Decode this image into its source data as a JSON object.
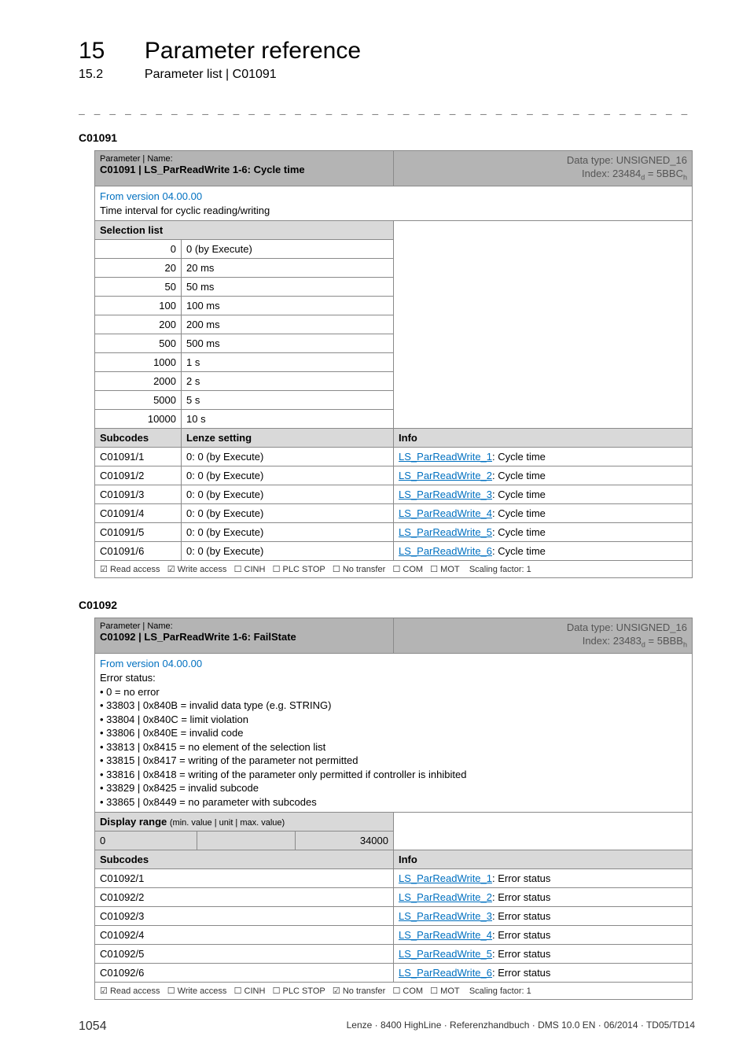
{
  "header": {
    "chapter_num": "15",
    "chapter_title": "Parameter reference",
    "section_num": "15.2",
    "section_title": "Parameter list | C01091",
    "rule": "_ _ _ _ _ _ _ _ _ _ _ _ _ _ _ _ _ _ _ _ _ _ _ _ _ _ _ _ _ _ _ _ _ _ _ _ _ _ _ _ _ _ _ _ _ _ _ _ _ _ _ _ _ _ _ _ _ _ _ _ _ _ _ _"
  },
  "t1": {
    "anchor": "C01091",
    "head_left_label": "Parameter | Name:",
    "head_left_title": "C01091 | LS_ParReadWrite 1-6: Cycle time",
    "head_right_1": "Data type: UNSIGNED_16",
    "head_right_2": "Index: 23484d = 5BBCh",
    "version": "From version 04.00.00",
    "desc": "Time interval for cyclic reading/writing",
    "sel_label": "Selection list",
    "rows": [
      {
        "k": "0",
        "v": "0 (by Execute)"
      },
      {
        "k": "20",
        "v": "20 ms"
      },
      {
        "k": "50",
        "v": "50 ms"
      },
      {
        "k": "100",
        "v": "100 ms"
      },
      {
        "k": "200",
        "v": "200 ms"
      },
      {
        "k": "500",
        "v": "500 ms"
      },
      {
        "k": "1000",
        "v": "1 s"
      },
      {
        "k": "2000",
        "v": "2 s"
      },
      {
        "k": "5000",
        "v": "5 s"
      },
      {
        "k": "10000",
        "v": "10 s"
      }
    ],
    "sub_h1": "Subcodes",
    "sub_h2": "Lenze setting",
    "sub_h3": "Info",
    "subs": [
      {
        "c": "C01091/1",
        "s": "0: 0 (by Execute)",
        "l": "LS_ParReadWrite_1",
        "t": ": Cycle time"
      },
      {
        "c": "C01091/2",
        "s": "0: 0 (by Execute)",
        "l": "LS_ParReadWrite_2",
        "t": ": Cycle time"
      },
      {
        "c": "C01091/3",
        "s": "0: 0 (by Execute)",
        "l": "LS_ParReadWrite_3",
        "t": ": Cycle time"
      },
      {
        "c": "C01091/4",
        "s": "0: 0 (by Execute)",
        "l": "LS_ParReadWrite_4",
        "t": ": Cycle time"
      },
      {
        "c": "C01091/5",
        "s": "0: 0 (by Execute)",
        "l": "LS_ParReadWrite_5",
        "t": ": Cycle time"
      },
      {
        "c": "C01091/6",
        "s": "0: 0 (by Execute)",
        "l": "LS_ParReadWrite_6",
        "t": ": Cycle time"
      }
    ],
    "foot": {
      "read": "Read access",
      "write": "Write access",
      "cinh": "CINH",
      "plc": "PLC STOP",
      "nt": "No transfer",
      "com": "COM",
      "mot": "MOT",
      "scale": "Scaling factor: 1",
      "read_c": "☑",
      "write_c": "☑",
      "cinh_c": "☐",
      "plc_c": "☐",
      "nt_c": "☐",
      "com_c": "☐",
      "mot_c": "☐"
    }
  },
  "t2": {
    "anchor": "C01092",
    "head_left_label": "Parameter | Name:",
    "head_left_title": "C01092 | LS_ParReadWrite 1-6: FailState",
    "head_right_1": "Data type: UNSIGNED_16",
    "head_right_2": "Index: 23483d = 5BBBh",
    "version": "From version 04.00.00",
    "desc_lines": [
      "Error status:",
      "• 0 = no error",
      "• 33803 | 0x840B = invalid data type (e.g. STRING)",
      "• 33804 | 0x840C = limit violation",
      "• 33806 | 0x840E = invalid code",
      "• 33813 | 0x8415 = no element of the selection list",
      "• 33815 | 0x8417 = writing of the parameter not permitted",
      "• 33816 | 0x8418 = writing of the parameter only permitted if controller is inhibited",
      "• 33829 | 0x8425 = invalid subcode",
      "• 33865 | 0x8449 = no parameter with subcodes"
    ],
    "display_label": "Display range (min. value | unit | max. value)",
    "range_min": "0",
    "range_max": "34000",
    "sub_h1": "Subcodes",
    "sub_h3": "Info",
    "subs": [
      {
        "c": "C01092/1",
        "l": "LS_ParReadWrite_1",
        "t": ": Error status"
      },
      {
        "c": "C01092/2",
        "l": "LS_ParReadWrite_2",
        "t": ": Error status"
      },
      {
        "c": "C01092/3",
        "l": "LS_ParReadWrite_3",
        "t": ": Error status"
      },
      {
        "c": "C01092/4",
        "l": "LS_ParReadWrite_4",
        "t": ": Error status"
      },
      {
        "c": "C01092/5",
        "l": "LS_ParReadWrite_5",
        "t": ": Error status"
      },
      {
        "c": "C01092/6",
        "l": "LS_ParReadWrite_6",
        "t": ": Error status"
      }
    ],
    "foot": {
      "read": "Read access",
      "write": "Write access",
      "cinh": "CINH",
      "plc": "PLC STOP",
      "nt": "No transfer",
      "com": "COM",
      "mot": "MOT",
      "scale": "Scaling factor: 1",
      "read_c": "☑",
      "write_c": "☐",
      "cinh_c": "☐",
      "plc_c": "☐",
      "nt_c": "☑",
      "com_c": "☐",
      "mot_c": "☐"
    }
  },
  "footer": {
    "page": "1054",
    "right": "Lenze · 8400 HighLine · Referenzhandbuch · DMS 10.0 EN · 06/2014 · TD05/TD14"
  }
}
